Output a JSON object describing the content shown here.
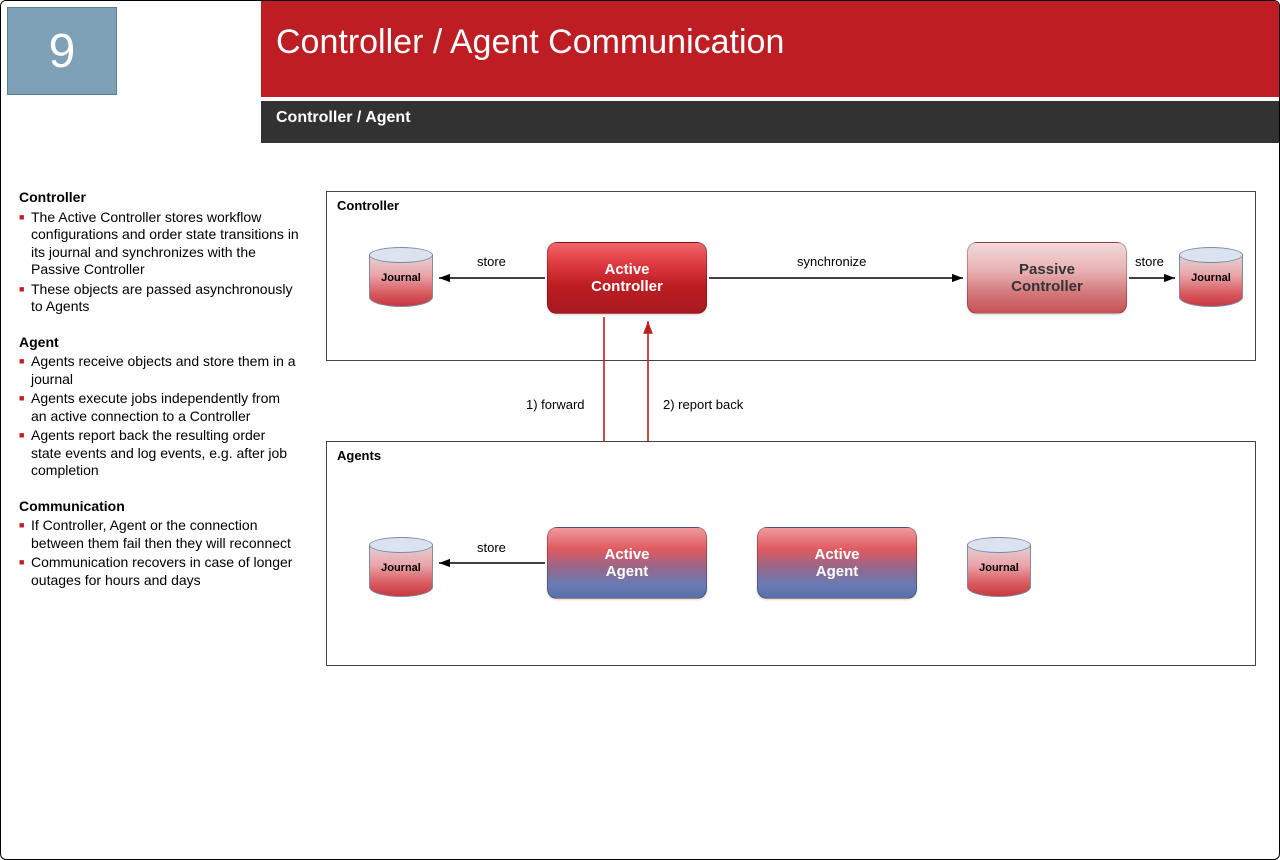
{
  "header": {
    "slide_number": "9",
    "title": "Controller / Agent Communication",
    "subtitle": "Controller / Agent"
  },
  "left": {
    "controller": {
      "heading": "Controller",
      "items": [
        "The Active Controller stores workflow configurations and order state transitions in its journal and synchronizes with the Passive Controller",
        "These objects are passed asynchronously to Agents"
      ]
    },
    "agent": {
      "heading": "Agent",
      "items": [
        "Agents receive objects and store them in a journal",
        "Agents execute jobs independently from an active connection to a Controller",
        "Agents report back the resulting order state events and log events, e.g. after job completion"
      ]
    },
    "communication": {
      "heading": "Communication",
      "items": [
        "If Controller, Agent or the connection between them fail then they will reconnect",
        "Communication recovers in case of longer outages for hours and days"
      ]
    }
  },
  "diagram": {
    "panels": {
      "controller": "Controller",
      "agents": "Agents"
    },
    "nodes": {
      "active_controller_l1": "Active",
      "active_controller_l2": "Controller",
      "passive_controller_l1": "Passive",
      "passive_controller_l2": "Controller",
      "active_agent1_l1": "Active",
      "active_agent1_l2": "Agent",
      "active_agent2_l1": "Active",
      "active_agent2_l2": "Agent"
    },
    "journals": {
      "c_left": "Journal",
      "c_right": "Journal",
      "a_left": "Journal",
      "a_right": "Journal"
    },
    "edges": {
      "store_ctrl_left": "store",
      "store_ctrl_right": "store",
      "synchronize": "synchronize",
      "store_agent_left": "store",
      "forward": "1) forward",
      "report_back": "2) report back"
    }
  }
}
